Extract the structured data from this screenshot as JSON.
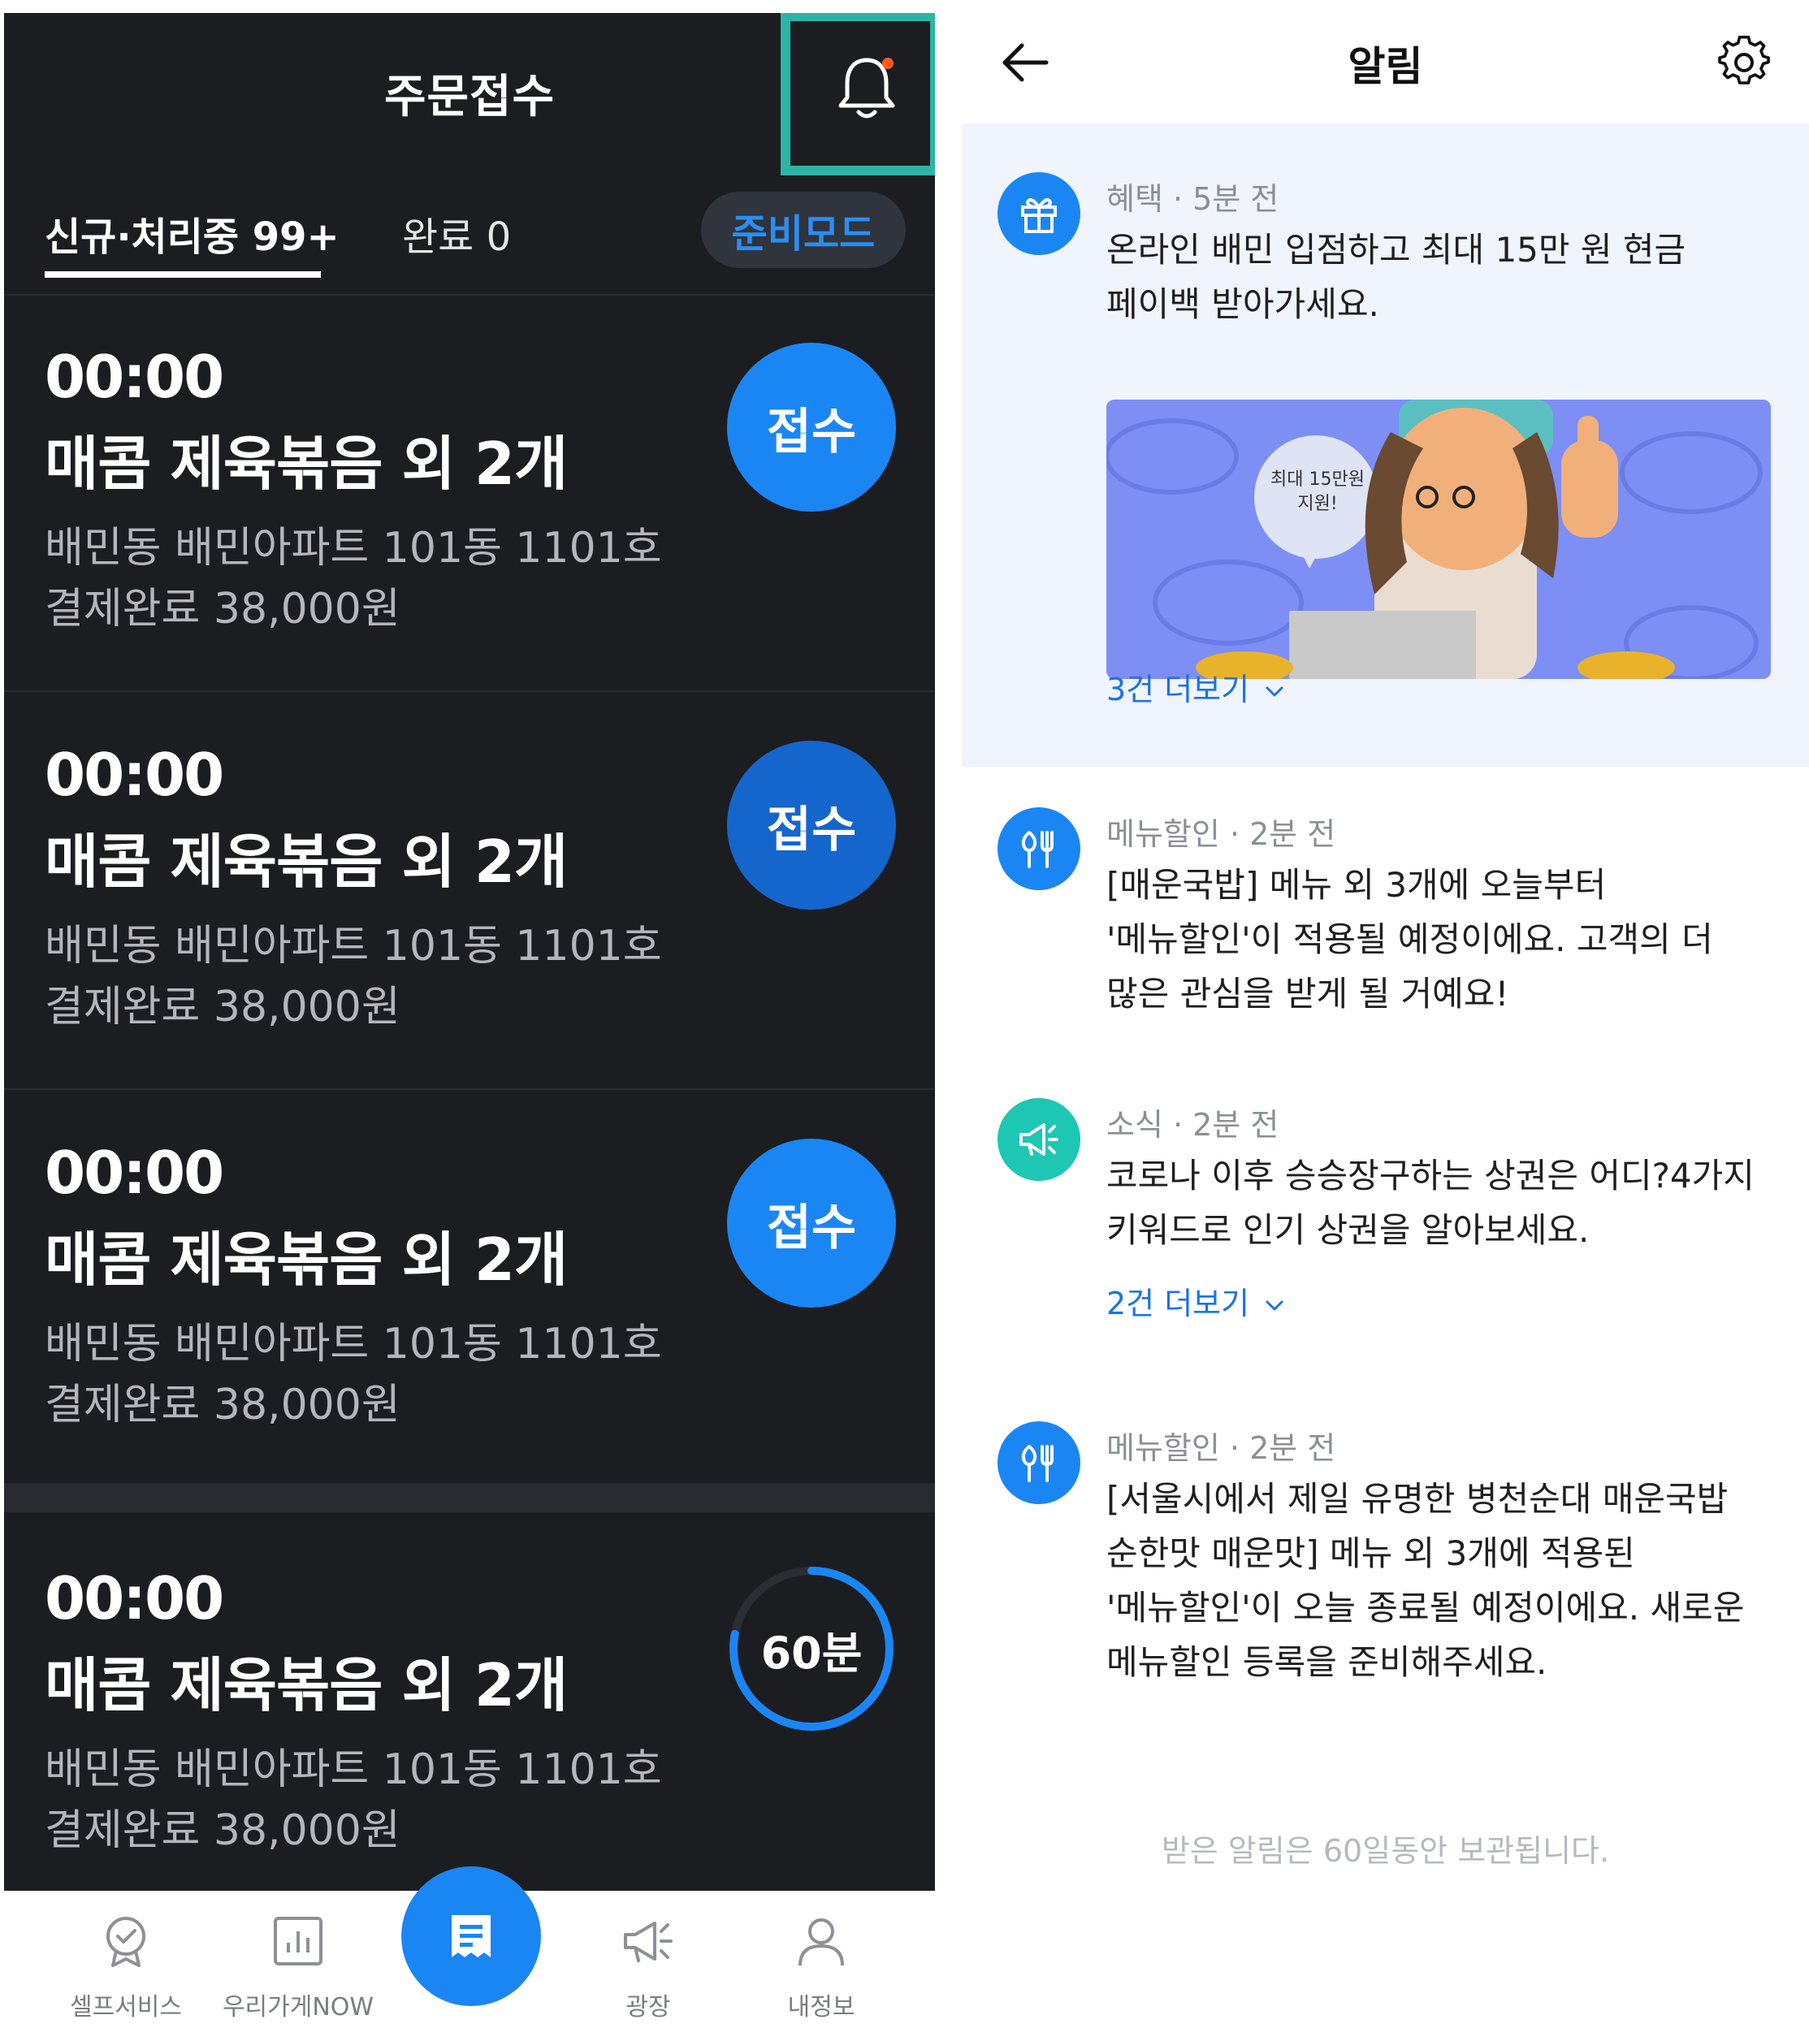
{
  "left_screen": {
    "title": "주문접수",
    "tabs": {
      "new_processing": "신규·처리중 99+",
      "done": "완료 0",
      "mode_button": "준비모드"
    },
    "orders": [
      {
        "time": "00:00",
        "menu": "매콤 제육볶음 외 2개",
        "address": "배민동 배민아파트 101동 1101호",
        "payment": "결제완료 38,000원",
        "action": "접수"
      },
      {
        "time": "00:00",
        "menu": "매콤 제육볶음 외 2개",
        "address": "배민동 배민아파트 101동 1101호",
        "payment": "결제완료 38,000원",
        "action": "접수"
      },
      {
        "time": "00:00",
        "menu": "매콤 제육볶음 외 2개",
        "address": "배민동 배민아파트 101동 1101호",
        "payment": "결제완료 38,000원",
        "action": "접수"
      },
      {
        "time": "00:00",
        "menu": "매콤 제육볶음 외 2개",
        "address": "배민동 배민아파트 101동 1101호",
        "payment": "결제완료 38,000원",
        "timer": "60분",
        "timer_progress": 0.78
      }
    ],
    "bottom_nav": [
      {
        "label": "셀프서비스",
        "icon": "badge-check-icon"
      },
      {
        "label": "우리가게NOW",
        "icon": "bar-chart-icon"
      },
      {
        "label": "",
        "icon": "order-receipt-icon"
      },
      {
        "label": "광장",
        "icon": "megaphone-icon"
      },
      {
        "label": "내정보",
        "icon": "person-icon"
      }
    ]
  },
  "right_screen": {
    "title": "알림",
    "notifications": [
      {
        "category": "혜택",
        "time": " · 5분 전",
        "icon": "gift-icon",
        "text": "온라인 배민 입점하고 최대 15만 원 현금 페이백 받아가세요.",
        "banner_text": "최대 15만원 지원!",
        "more": "3건 더보기"
      },
      {
        "category": "메뉴할인",
        "time": " · 2분 전",
        "icon": "fork-knife-icon",
        "text": "[매운국밥] 메뉴 외 3개에 오늘부터 '메뉴할인'이 적용될 예정이에요. 고객의 더 많은 관심을 받게 될 거예요!"
      },
      {
        "category": "소식",
        "time": " · 2분 전",
        "icon": "megaphone-icon",
        "text": "코로나 이후 승승장구하는 상권은 어디?4가지 키워드로 인기 상권을 알아보세요.",
        "more": "2건 더보기"
      },
      {
        "category": "메뉴할인",
        "time": " · 2분 전",
        "icon": "fork-knife-icon",
        "text": "[서울시에서 제일 유명한 병천순대 매운국밥 순한맛 매운맛] 메뉴 외 3개에 적용된 '메뉴할인'이 오늘 종료될 예정이에요. 새로운 메뉴할인 등록을 준비해주세요."
      }
    ],
    "footer": "받은 알림은 60일동안 보관됩니다."
  },
  "colors": {
    "dark_bg": "#1c1d21",
    "accent_blue": "#1a86f4",
    "highlight_teal": "#2cb5a7",
    "notification_dot": "#ff5a1f",
    "news_teal": "#1ec6b4"
  }
}
